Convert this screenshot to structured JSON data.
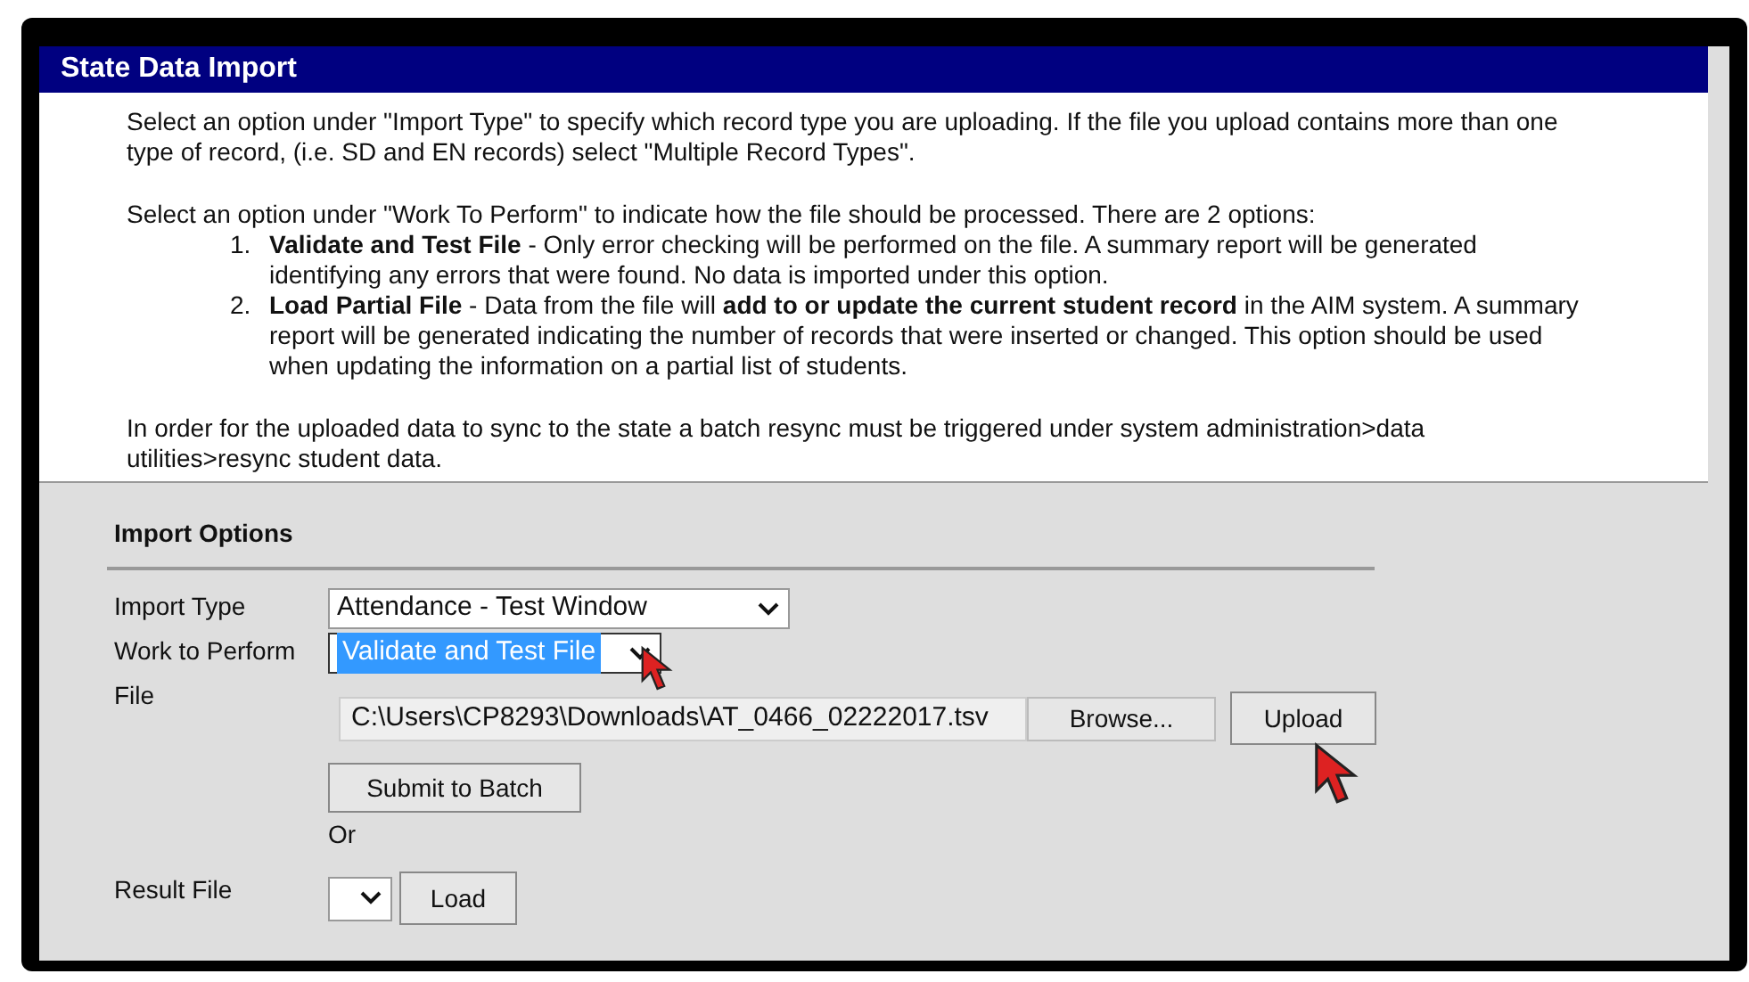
{
  "panel": {
    "title": "State Data Import"
  },
  "instructions": {
    "intro": "Select an option under \"Import Type\" to specify which record type you are uploading. If the file you upload contains more than one type of record, (i.e. SD and EN records) select \"Multiple Record Types\".",
    "work_intro": "Select an option under \"Work To Perform\" to indicate how the file should be processed. There are 2 options:",
    "options": [
      {
        "number": "1.",
        "text": "**Validate and Test File** - Only error checking will be performed on the file. A summary report will be generated identifying any errors that were found. No data is imported under this option."
      },
      {
        "number": "2.",
        "text": "**Load Partial File** - Data from the file will **add to or update the current student record** in the AIM system. A summary report will be generated indicating the number of records that were inserted or changed. This option should be used when updating the information on a partial list of students."
      }
    ],
    "sync_note": "In order for the uploaded data to sync to the state a batch resync must be triggered under system administration>data utilities>resync student data."
  },
  "import_options": {
    "heading": "Import Options",
    "import_type": {
      "label": "Import Type",
      "value": "Attendance - Test Window"
    },
    "work_to_perform": {
      "label": "Work to Perform",
      "value": "Validate and Test File",
      "selected": true
    },
    "file": {
      "label": "File",
      "value": "C:\\Users\\CP8293\\Downloads\\AT_0466_02222017.tsv",
      "browse_button": "Browse...",
      "upload_button": "Upload"
    },
    "submit_button": "Submit to Batch",
    "or_text": "Or",
    "result_file": {
      "label": "Result File",
      "load_button": "Load"
    }
  }
}
